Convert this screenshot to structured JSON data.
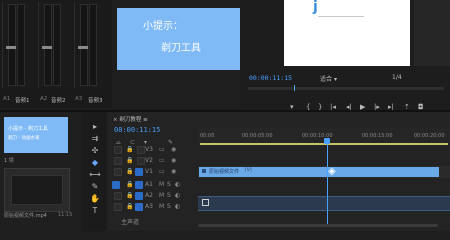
{
  "audio_mixer": {
    "channels": [
      {
        "name": "A1",
        "label": "音频1"
      },
      {
        "name": "A2",
        "label": "音频2"
      },
      {
        "name": "A3",
        "label": "音频3"
      }
    ]
  },
  "tip_card": {
    "title": "小提示：",
    "body": "剃刀工具"
  },
  "program_monitor": {
    "canvas_char": "j",
    "timecode": "00:00:11:15",
    "fit_label": "适合",
    "ratio_label": "1/4"
  },
  "project_panel": {
    "clip_name": "小提示 - 剃刀工具",
    "clip_caption": "剃刀 - 动画水果",
    "item_count": "1 项",
    "bottom_item": "原始视频文件.mp4",
    "bottom_duration": "11:15"
  },
  "timeline": {
    "panel_title": "剃刀教程 ≡",
    "timecode": "00:00:11:15",
    "ruler_labels": [
      "00:00",
      "00:00:05:00",
      "00:00:10:00",
      "00:00:15:00",
      "00:00:20:00"
    ],
    "video_tracks": [
      "V3",
      "V2",
      "V1"
    ],
    "audio_tracks": [
      "A1",
      "A2",
      "A3"
    ],
    "main_track": "主声道",
    "clip_label": "原始视频文件",
    "clip_sublabel": "[V]",
    "accent_color": "#6aa9e8",
    "playhead_color": "#4a9fff",
    "tip_bg": "#7fbaf6"
  }
}
